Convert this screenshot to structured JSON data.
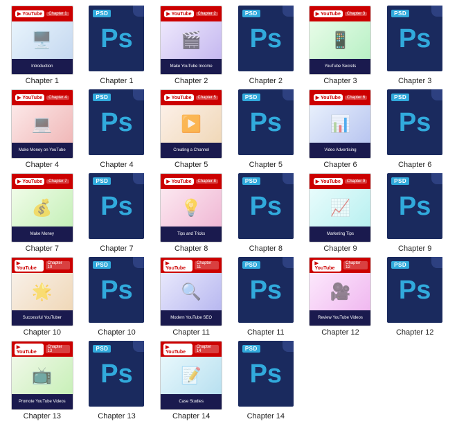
{
  "items": [
    {
      "id": 1,
      "type": "yt",
      "label": "Chapter 1",
      "icon": "🖥️",
      "subtitle": "Introduction"
    },
    {
      "id": 2,
      "type": "psd",
      "label": "Chapter 1"
    },
    {
      "id": 3,
      "type": "yt",
      "label": "Chapter 2",
      "icon": "🎬",
      "subtitle": "Make YouTube Income"
    },
    {
      "id": 4,
      "type": "psd",
      "label": "Chapter 2"
    },
    {
      "id": 5,
      "type": "yt",
      "label": "Chapter 3",
      "icon": "📱",
      "subtitle": "YouTube Secrets"
    },
    {
      "id": 6,
      "type": "psd",
      "label": "Chapter 3"
    },
    {
      "id": 7,
      "type": "yt",
      "label": "Chapter 4",
      "icon": "💻",
      "subtitle": "Make Money on YouTube"
    },
    {
      "id": 8,
      "type": "psd",
      "label": "Chapter 4"
    },
    {
      "id": 9,
      "type": "yt",
      "label": "Chapter 5",
      "icon": "▶️",
      "subtitle": "Creating a Channel"
    },
    {
      "id": 10,
      "type": "psd",
      "label": "Chapter 5"
    },
    {
      "id": 11,
      "type": "yt",
      "label": "Chapter 6",
      "icon": "📊",
      "subtitle": "Video Advertising"
    },
    {
      "id": 12,
      "type": "psd",
      "label": "Chapter 6"
    },
    {
      "id": 13,
      "type": "yt",
      "label": "Chapter 7",
      "icon": "💰",
      "subtitle": "Make Money"
    },
    {
      "id": 14,
      "type": "psd",
      "label": "Chapter 7"
    },
    {
      "id": 15,
      "type": "yt",
      "label": "Chapter 8",
      "icon": "💡",
      "subtitle": "Tips and Tricks"
    },
    {
      "id": 16,
      "type": "psd",
      "label": "Chapter 8"
    },
    {
      "id": 17,
      "type": "yt",
      "label": "Chapter 9",
      "icon": "📈",
      "subtitle": "Marketing Tips"
    },
    {
      "id": 18,
      "type": "psd",
      "label": "Chapter 9"
    },
    {
      "id": 19,
      "type": "yt",
      "label": "Chapter 10",
      "icon": "🌟",
      "subtitle": "Successful YouTuber"
    },
    {
      "id": 20,
      "type": "psd",
      "label": "Chapter 10"
    },
    {
      "id": 21,
      "type": "yt",
      "label": "Chapter 11",
      "icon": "🔍",
      "subtitle": "Modern YouTube SEO"
    },
    {
      "id": 22,
      "type": "psd",
      "label": "Chapter 11"
    },
    {
      "id": 23,
      "type": "yt",
      "label": "Chapter 12",
      "icon": "🎥",
      "subtitle": "Review YouTube Videos"
    },
    {
      "id": 24,
      "type": "psd",
      "label": "Chapter 12"
    },
    {
      "id": 25,
      "type": "yt",
      "label": "Chapter 13",
      "icon": "📺",
      "subtitle": "Promote YouTube Videos"
    },
    {
      "id": 26,
      "type": "psd",
      "label": "Chapter 13"
    },
    {
      "id": 27,
      "type": "yt",
      "label": "Chapter 14",
      "icon": "📝",
      "subtitle": "Case Studies"
    },
    {
      "id": 28,
      "type": "psd",
      "label": "Chapter 14"
    }
  ],
  "psd_label": "PSD",
  "yt_brand": "You Tube"
}
